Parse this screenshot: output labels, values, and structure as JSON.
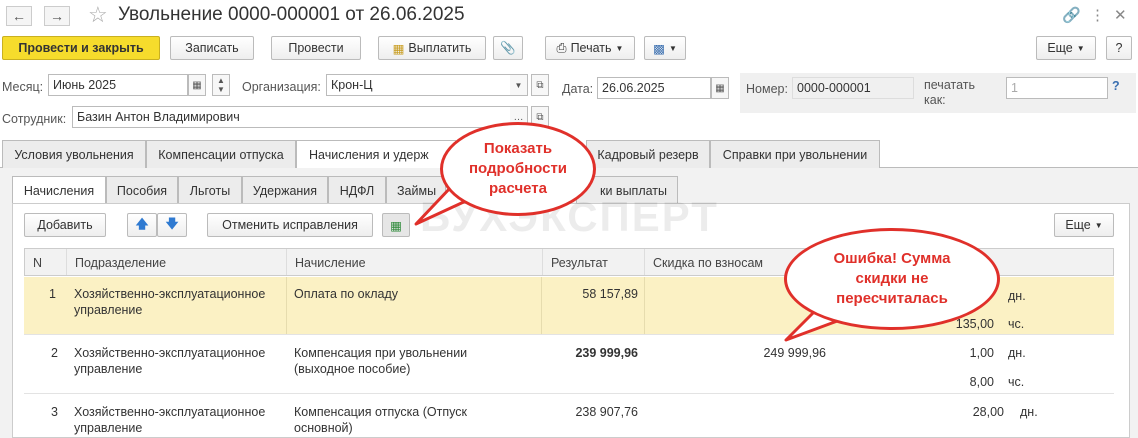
{
  "window": {
    "title": "Увольнение 0000-000001 от 26.06.2025",
    "back_icon": "arrow-left-icon",
    "forward_icon": "arrow-right-icon"
  },
  "toolbar": {
    "post_close": "Провести и закрыть",
    "save": "Записать",
    "post": "Провести",
    "pay": "Выплатить",
    "print": "Печать",
    "more": "Еще",
    "help": "?"
  },
  "form": {
    "month_label": "Месяц:",
    "month_value": "Июнь 2025",
    "org_label": "Организация:",
    "org_value": "Крон-Ц",
    "date_label": "Дата:",
    "date_value": "26.06.2025",
    "number_label": "Номер:",
    "number_value": "0000-000001",
    "print_as_label": "печатать как:",
    "print_as_value": "1",
    "employee_label": "Сотрудник:",
    "employee_value": "Базин Антон Владимирович"
  },
  "tabs": [
    "Условия увольнения",
    "Компенсации отпуска",
    "Начисления и удерж",
    "Кадровый резерв",
    "Справки при увольнении"
  ],
  "subtabs": [
    "Начисления",
    "Пособия",
    "Льготы",
    "Удержания",
    "НДФЛ",
    "Займы",
    "ки выплаты"
  ],
  "subtoolbar": {
    "add": "Добавить",
    "cancel_fix": "Отменить исправления",
    "more": "Еще"
  },
  "watermark": "БУХЭКСПЕРТ",
  "table": {
    "headers": [
      "N",
      "Подразделение",
      "Начисление",
      "Результат",
      "Скидка по взносам"
    ],
    "rows": [
      {
        "n": "1",
        "dept1": "Хозяйственно-эксплуатационное",
        "dept2": "управление",
        "acc1": "Оплата по окладу",
        "acc2": "",
        "result": "58 157,89",
        "discount": "",
        "v1": "",
        "u1": "дн.",
        "v2": "135,00",
        "u2": "чс."
      },
      {
        "n": "2",
        "dept1": "Хозяйственно-эксплуатационное",
        "dept2": "управление",
        "acc1": "Компенсация при увольнении",
        "acc2": "(выходное пособие)",
        "result": "239 999,96",
        "discount": "249 999,96",
        "v1": "1,00",
        "u1": "дн.",
        "v2": "8,00",
        "u2": "чс."
      },
      {
        "n": "3",
        "dept1": "Хозяйственно-эксплуатационное",
        "dept2": "управление",
        "acc1": "Компенсация отпуска (Отпуск",
        "acc2": "основной)",
        "result": "238 907,76",
        "discount": "",
        "v1": "28,00",
        "u1": "дн.",
        "v2": "",
        "u2": ""
      }
    ]
  },
  "callouts": {
    "details": "Показать подробности расчета",
    "error": "Ошибка! Сумма скидки не пересчиталась"
  }
}
